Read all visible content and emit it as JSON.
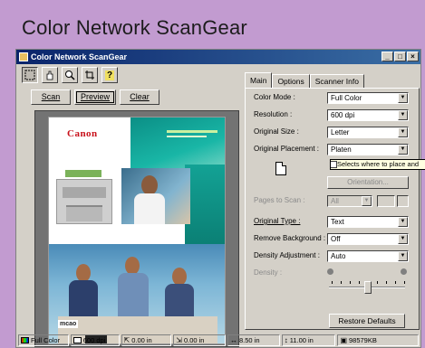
{
  "heading": "Color Network ScanGear",
  "window": {
    "title": "Color Network ScanGear",
    "buttons": {
      "minimize": "_",
      "maximize": "□",
      "close": "×"
    }
  },
  "toolbar": {
    "help_label": "?"
  },
  "preview_buttons": {
    "scan": "Scan",
    "preview": "Preview",
    "clear": "Clear"
  },
  "document": {
    "brand": "Canon",
    "logo": "mcao"
  },
  "tabs": [
    "Main",
    "Options",
    "Scanner Info"
  ],
  "main": {
    "color_mode": {
      "label": "Color Mode :",
      "value": "Full Color"
    },
    "resolution": {
      "label": "Resolution :",
      "value": "600 dpi"
    },
    "original_size": {
      "label": "Original Size :",
      "value": "Letter"
    },
    "original_placement": {
      "label": "Original Placement :",
      "value": "Platen"
    },
    "tooltip": "Selects where to place and",
    "orientation_button": "Orientation...",
    "pages_to_scan": {
      "label": "Pages to Scan :",
      "value": "All"
    },
    "original_type": {
      "label": "Original Type :",
      "value": "Text"
    },
    "remove_background": {
      "label": "Remove Background :",
      "value": "Off"
    },
    "density_adjustment": {
      "label": "Density Adjustment :",
      "value": "Auto"
    },
    "density": {
      "label": "Density :"
    },
    "restore_defaults": "Restore Defaults"
  },
  "status": {
    "mode": "Full Color",
    "resolution": "600 dpi",
    "x": "0.00 in",
    "y": "0.00 in",
    "width": "8.50 in",
    "height": "11.00 in",
    "size": "98579KB"
  },
  "colors": {
    "background": "#c29bd0",
    "titlebar": "#0a246a",
    "brand": "#c8101a"
  }
}
